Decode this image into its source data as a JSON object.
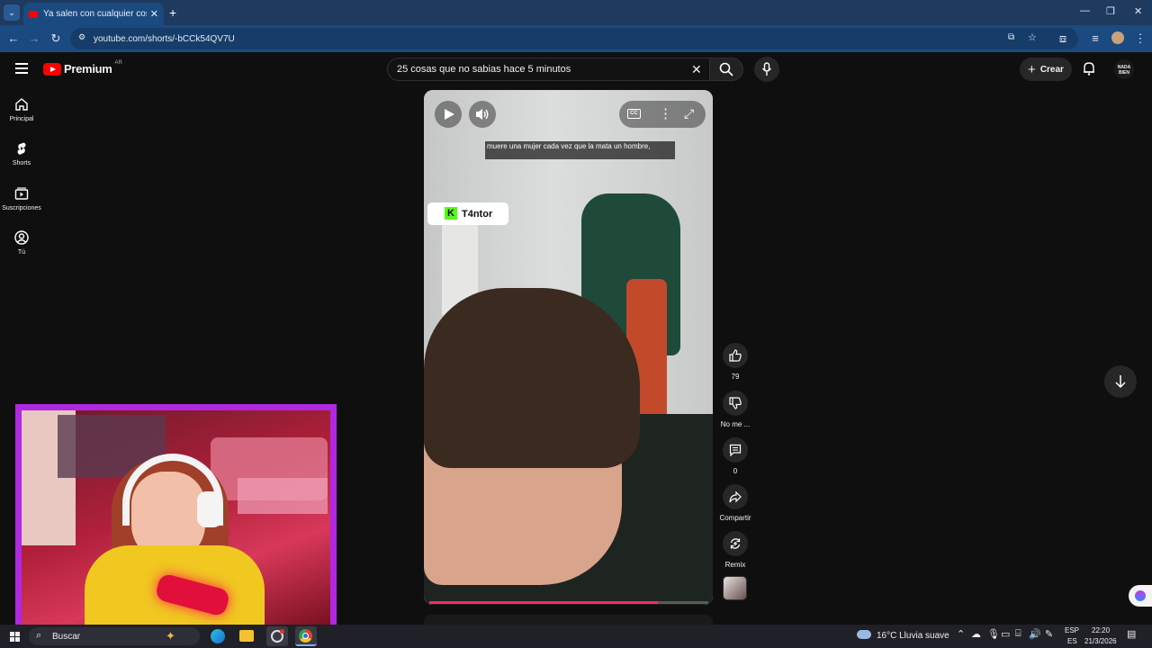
{
  "browser": {
    "tab_title": "Ya salen con cualquier cosa - YouTube",
    "url": "youtube.com/shorts/-bCCk54QV7U"
  },
  "youtube": {
    "brand": "Premium",
    "region": "AR",
    "search_value": "25 cosas que no sabias hace 5 minutos",
    "create_label": "Crear",
    "avatar_text": "NADA BIEN"
  },
  "sidebar": {
    "items": [
      {
        "label": "Principal",
        "icon": "home-icon"
      },
      {
        "label": "Shorts",
        "icon": "shorts-icon"
      },
      {
        "label": "Suscripciones",
        "icon": "subscriptions-icon"
      },
      {
        "label": "Tú",
        "icon": "user-icon"
      }
    ]
  },
  "video": {
    "caption": "muere una mujer cada vez que la mata un hombre,",
    "chip_label": "T4ntor",
    "progress": 0.82
  },
  "actions": {
    "like_count": "79",
    "dislike_label": "No me ...",
    "comment_count": "0",
    "share_label": "Compartir",
    "remix_label": "Remix"
  },
  "taskbar": {
    "search_placeholder": "Buscar",
    "weather": "16°C  Lluvia suave",
    "lang_top": "ESP",
    "lang_bottom": "ES",
    "time": "22:20",
    "date": "21/3/2026"
  },
  "colors": {
    "youtube_red": "#ff0000",
    "chrome_blue": "#1b4a80",
    "webcam_border": "#a020d0",
    "progress": "#ff2a5a"
  }
}
